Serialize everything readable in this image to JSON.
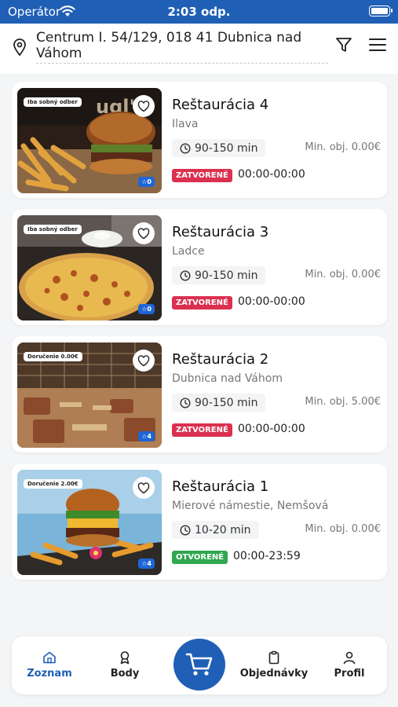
{
  "status_bar": {
    "carrier": "Operátor",
    "time": "2:03 odp."
  },
  "header": {
    "address": "Centrum I. 54/129, 018 41 Dubnica nad Váhom"
  },
  "restaurants": [
    {
      "name": "Reštaurácia 4",
      "city": "Ilava",
      "delivery_time": "90-150 min",
      "min_order": "Min. obj. 0.00€",
      "status": "ZATVORENÉ",
      "hours": "00:00-00:00",
      "badge": "Iba sobný odber",
      "rating": "0"
    },
    {
      "name": "Reštaurácia 3",
      "city": "Ladce",
      "delivery_time": "90-150 min",
      "min_order": "Min. obj. 0.00€",
      "status": "ZATVORENÉ",
      "hours": "00:00-00:00",
      "badge": "Iba sobný odber",
      "rating": "0"
    },
    {
      "name": "Reštaurácia 2",
      "city": "Dubnica nad Váhom",
      "delivery_time": "90-150 min",
      "min_order": "Min. obj. 5.00€",
      "status": "ZATVORENÉ",
      "hours": "00:00-00:00",
      "badge": "Doručenie 0.00€",
      "rating": "4"
    },
    {
      "name": "Reštaurácia 1",
      "city": "Mierové námestie, Nemšová",
      "delivery_time": "10-20 min",
      "min_order": "Min. obj. 0.00€",
      "status": "OTVORENÉ",
      "hours": "00:00-23:59",
      "badge": "Doručenie 2.00€",
      "rating": "4"
    }
  ],
  "nav": {
    "list": "Zoznam",
    "points": "Body",
    "orders": "Objednávky",
    "profile": "Profil"
  },
  "colors": {
    "primary": "#1f5fb5",
    "closed": "#db3050",
    "open": "#2fa84f",
    "rating": "#1e66d6"
  },
  "icons": {
    "status": [
      "wifi-icon",
      "battery-icon"
    ],
    "header": [
      "location-pin-icon",
      "filter-icon",
      "menu-icon"
    ],
    "card": [
      "heart-icon",
      "star-icon",
      "clock-icon"
    ],
    "nav": [
      "home-icon",
      "award-icon",
      "cart-icon",
      "clipboard-icon",
      "person-icon"
    ]
  }
}
